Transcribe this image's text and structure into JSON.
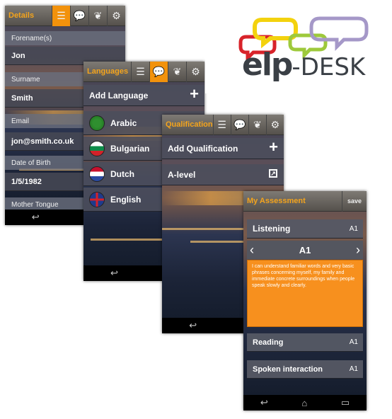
{
  "details": {
    "title": "Details",
    "fields": [
      {
        "label": "Forename(s)",
        "value": "Jon"
      },
      {
        "label": "Surname",
        "value": "Smith"
      },
      {
        "label": "Email",
        "value": "jon@smith.co.uk"
      },
      {
        "label": "Date of Birth",
        "value": "1/5/1982"
      },
      {
        "label": "Mother Tongue",
        "value": ""
      }
    ]
  },
  "languages": {
    "title": "Languages",
    "add_label": "Add Language",
    "items": [
      "Arabic",
      "Bulgarian",
      "Dutch",
      "English"
    ]
  },
  "qualification": {
    "title": "Qualification",
    "add_label": "Add Qualification",
    "items": [
      "A-level"
    ]
  },
  "assessment": {
    "title": "My Assessment",
    "save_label": "save",
    "current_skill": "Listening",
    "current_level": "A1",
    "selected_level": "A1",
    "description": "I can understand familiar words and very basic phrases concerning myself, my family and immediate concrete surroundings when people speak slowly and clearly.",
    "other_skills": [
      {
        "name": "Reading",
        "level": "A1"
      },
      {
        "name": "Spoken interaction",
        "level": "A1"
      }
    ]
  },
  "logo": {
    "text_elp": "elp",
    "text_desk": "-DESK",
    "colors": {
      "yellow": "#f3d20e",
      "red": "#d8232a",
      "green": "#9ec93b",
      "purple": "#a598c8",
      "dark": "#3a3f45"
    }
  },
  "icons": {
    "list": "list-icon",
    "speech": "speech-bubbles-icon",
    "badge": "badge-icon",
    "settings": "gear-icon",
    "back": "back-arrow-icon",
    "home": "home-icon",
    "recent": "recent-apps-icon"
  }
}
